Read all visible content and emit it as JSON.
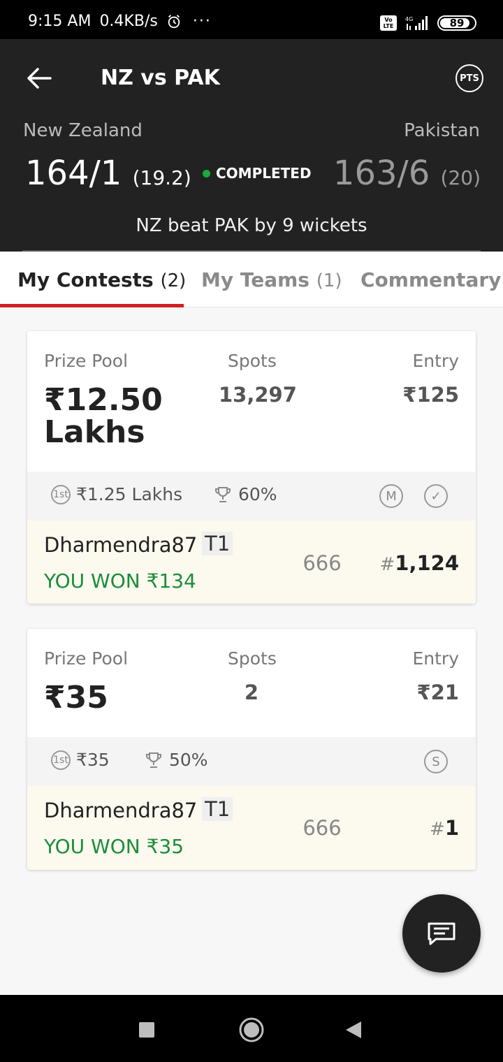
{
  "status_bar": {
    "time": "9:15 AM",
    "speed": "0.4KB/s",
    "more": "···",
    "volte_top": "Vo",
    "volte_bottom": "LTE",
    "network": "4G",
    "battery": "89"
  },
  "header": {
    "title": "NZ vs PAK",
    "pts_label": "PTS",
    "team_left": {
      "name": "New Zealand",
      "score": "164/1",
      "overs": "(19.2)"
    },
    "team_right": {
      "name": "Pakistan",
      "score": "163/6",
      "overs": "(20)"
    },
    "status": "COMPLETED",
    "result": "NZ beat PAK by 9 wickets"
  },
  "tabs": [
    {
      "label": "My Contests",
      "count": "(2)"
    },
    {
      "label": "My Teams",
      "count": "(1)"
    },
    {
      "label": "Commentary"
    }
  ],
  "contests": [
    {
      "prize_pool_label": "Prize Pool",
      "prize_pool": "₹12.50 Lakhs",
      "spots_label": "Spots",
      "spots": "13,297",
      "entry_label": "Entry",
      "entry": "₹125",
      "first_prize_icon": "1st",
      "first_prize": "₹1.25 Lakhs",
      "win_percent": "60%",
      "badges": [
        "M",
        "✓"
      ],
      "user": "Dharmendra87",
      "team": "T1",
      "won": "YOU WON ₹134",
      "points": "666",
      "rank_hash": "#",
      "rank": "1,124"
    },
    {
      "prize_pool_label": "Prize Pool",
      "prize_pool": "₹35",
      "spots_label": "Spots",
      "spots": "2",
      "entry_label": "Entry",
      "entry": "₹21",
      "first_prize_icon": "1st",
      "first_prize": "₹35",
      "win_percent": "50%",
      "badges": [
        "S"
      ],
      "user": "Dharmendra87",
      "team": "T1",
      "won": "YOU WON ₹35",
      "points": "666",
      "rank_hash": "#",
      "rank": "1"
    }
  ],
  "colors": {
    "header_bg": "#222222",
    "accent_red": "#d11f24",
    "won_green": "#1a8d3b",
    "status_green": "#1aab3a"
  },
  "icons": [
    "back-arrow-icon",
    "pts-icon",
    "first-prize-icon",
    "trophy-icon",
    "multi-entry-icon",
    "guaranteed-icon",
    "single-entry-icon",
    "chat-icon",
    "recents-icon",
    "home-icon",
    "back-icon"
  ]
}
